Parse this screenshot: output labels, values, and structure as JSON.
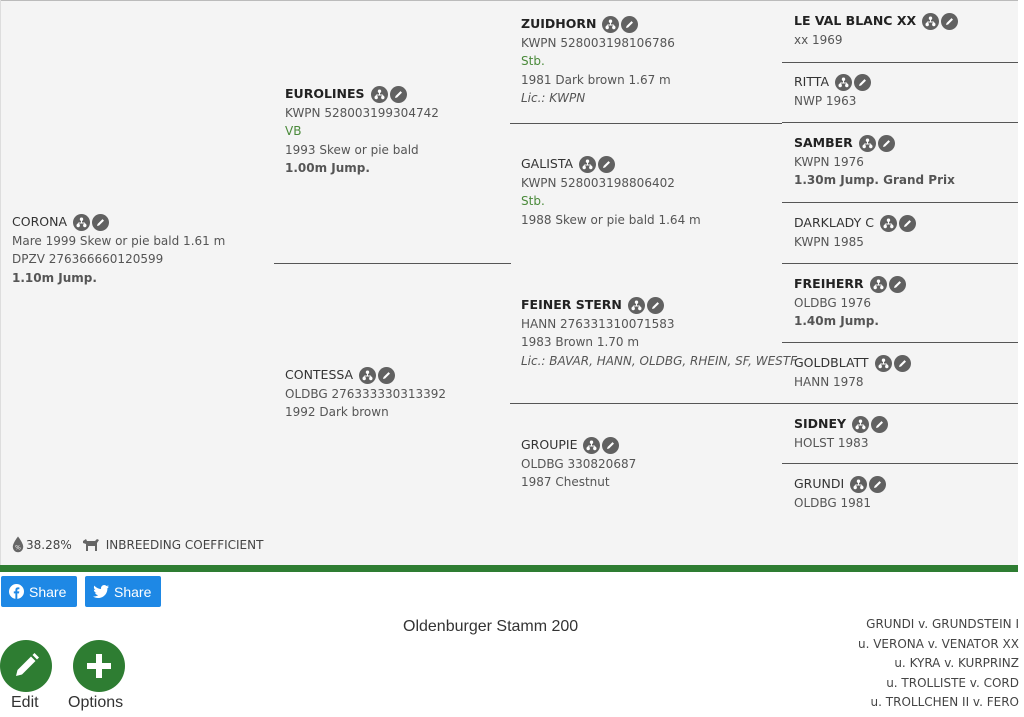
{
  "subject": {
    "name": "CORONA",
    "lines": [
      "Mare 1999 Skew or pie bald 1.61 m",
      "DPZV 276366660120599"
    ],
    "bold": "1.10m Jump."
  },
  "sire": {
    "name": "EUROLINES",
    "lines": [
      "KWPN 528003199304742"
    ],
    "green": "VB",
    "lines2": [
      "1993 Skew or pie bald"
    ],
    "bold": "1.00m Jump."
  },
  "dam": {
    "name": "CONTESSA",
    "lines": [
      "OLDBG 276333330313392",
      "1992 Dark brown"
    ]
  },
  "ss": {
    "name": "ZUIDHORN",
    "lines": [
      "KWPN 528003198106786"
    ],
    "green": "Stb.",
    "lines2": [
      "1981 Dark brown 1.67 m"
    ],
    "italic": "Lic.: KWPN"
  },
  "sd": {
    "name": "GALISTA",
    "lines": [
      "KWPN 528003198806402"
    ],
    "green": "Stb.",
    "lines2": [
      "1988 Skew or pie bald 1.64 m"
    ]
  },
  "ds": {
    "name": "FEINER STERN",
    "lines": [
      "HANN 276331310071583",
      "1983 Brown 1.70 m"
    ],
    "italic": "Lic.: BAVAR, HANN, OLDBG, RHEIN, SF, WESTF"
  },
  "dd": {
    "name": "GROUPIE",
    "lines": [
      "OLDBG 330820687",
      "1987 Chestnut"
    ]
  },
  "g1": {
    "name": "LE VAL BLANC XX",
    "line": "xx 1969"
  },
  "g2": {
    "name": "RITTA",
    "line": "NWP 1963"
  },
  "g3": {
    "name": "SAMBER",
    "line": "KWPN 1976",
    "bold": "1.30m Jump. Grand Prix"
  },
  "g4": {
    "name": "DARKLADY C",
    "line": "KWPN 1985"
  },
  "g5": {
    "name": "FREIHERR",
    "line": "OLDBG 1976",
    "bold": "1.40m Jump."
  },
  "g6": {
    "name": "GOLDBLATT",
    "line": "HANN 1978"
  },
  "g7": {
    "name": "SIDNEY",
    "line": "HOLST 1983"
  },
  "g8": {
    "name": "GRUNDI",
    "line": "OLDBG 1981"
  },
  "inbreeding": {
    "percent": "38.28%",
    "label": "INBREEDING COEFFICIENT"
  },
  "share": {
    "facebook": "Share",
    "twitter": "Share"
  },
  "buttons": {
    "edit": "Edit",
    "options": "Options"
  },
  "title": "Oldenburger Stamm 200",
  "lineage": [
    "GRUNDI v. GRUNDSTEIN I",
    "u. VERONA v. VENATOR XX",
    "u. KYRA v. KURPRINZ",
    "u. TROLLISTE v. CORD",
    "u. TROLLCHEN II v. FERO"
  ],
  "colors": {
    "accent_green": "#2e7d32",
    "share_blue": "#1e88e5",
    "icon_gray": "#616161"
  },
  "icons": {
    "tree": "pedigree-icon",
    "edit": "pencil-icon"
  }
}
